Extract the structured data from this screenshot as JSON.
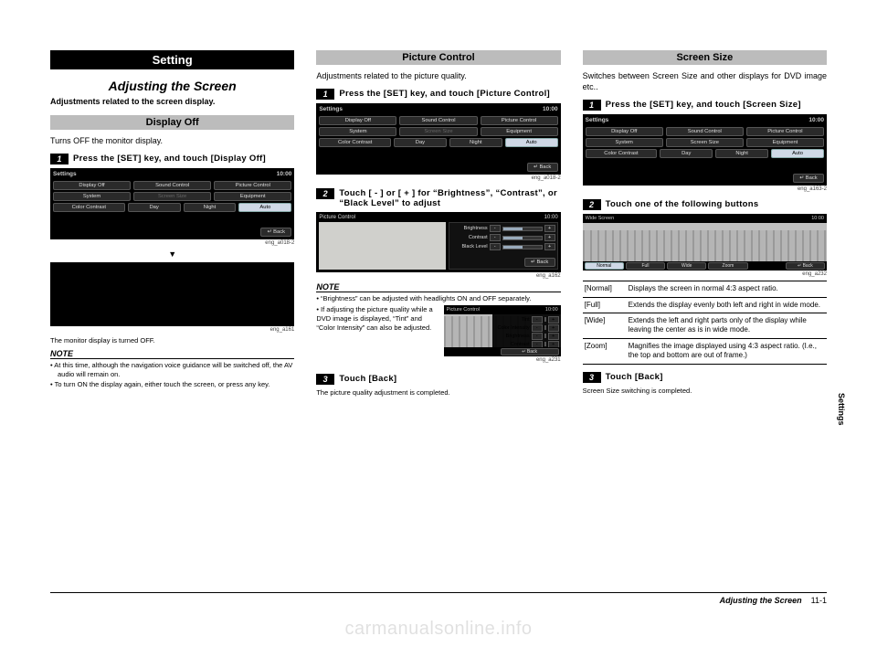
{
  "col1": {
    "setting_block": "Setting",
    "section_title": "Adjusting the Screen",
    "section_sub": "Adjustments related to the screen display.",
    "display_off_head": "Display Off",
    "p1": "Turns OFF the monitor display.",
    "step1": "Press the [SET] key, and touch [Display Off]",
    "fig1_cap": "eng_a018-2",
    "fig2_cap": "eng_a161",
    "monitor_off_small": "The monitor display is turned OFF.",
    "note_head": "NOTE",
    "note_items": [
      "At this time, although the navigation voice guidance will be switched off, the AV audio will remain on.",
      "To turn ON the display again, either touch the screen, or press any key."
    ]
  },
  "col2": {
    "picture_control_head": "Picture Control",
    "p1": "Adjustments related to the picture quality.",
    "step1": "Press the [SET] key, and touch [Picture Control]",
    "fig1_cap": "eng_a018-2",
    "step2": "Touch [ - ] or [ + ] for “Brightness”, “Contrast”, or “Black Level” to adjust",
    "fig2_cap": "eng_a162",
    "note_head": "NOTE",
    "note_item1": "“Brightness” can be adjusted with headlights ON and OFF separately.",
    "note_item2": "If adjusting the picture quality while a DVD image is displayed, “Tint” and “Color Intensity” can also be adjusted.",
    "inset_cap": "eng_a231",
    "step3": "Touch [Back]",
    "p_after3": "The picture quality adjustment is completed."
  },
  "col3": {
    "screen_size_head": "Screen Size",
    "p1": "Switches between Screen Size and other displays for DVD image etc..",
    "step1": "Press the [SET] key, and touch [Screen Size]",
    "fig1_cap": "eng_a163-2",
    "step2": "Touch one of the following buttons",
    "fig2_cap": "eng_a232",
    "table": [
      {
        "k": "[Normal]",
        "v": "Displays the screen in normal 4:3 aspect ratio."
      },
      {
        "k": "[Full]",
        "v": "Extends the display evenly both left and right in wide mode."
      },
      {
        "k": "[Wide]",
        "v": "Extends the left and right parts only of the display while leaving the center as is in wide mode."
      },
      {
        "k": "[Zoom]",
        "v": "Magnifies the image displayed using 4:3 aspect ratio. (I.e., the top and bottom are out of frame.)"
      }
    ],
    "step3": "Touch [Back]",
    "p_after3": "Screen Size switching is completed."
  },
  "screens": {
    "settings": {
      "title": "Settings",
      "time": "10:00",
      "row1": [
        "Display Off",
        "Sound Control",
        "Picture Control"
      ],
      "row2": [
        "System",
        "Screen Size",
        "Equipment"
      ],
      "cc_label": "Color Contrast",
      "cc_opts": [
        "Day",
        "Night",
        "Auto"
      ],
      "back": "Back"
    },
    "picture_sliders": {
      "title": "Picture Control",
      "time": "10:00",
      "rows": [
        "Brightness",
        "Contrast",
        "Black Level"
      ],
      "back": "Back"
    },
    "picture_sliders_dvd": {
      "title": "Picture Control",
      "time": "10:00",
      "rows": [
        "Tint",
        "Color Intensity",
        "Brightness",
        "Contrast",
        "Black Level"
      ],
      "back": "Back"
    },
    "wide": {
      "title": "Wide Screen",
      "time": "10:00",
      "opts": [
        "Normal",
        "Full",
        "Wide",
        "Zoom"
      ],
      "back": "Back"
    }
  },
  "side_tab": "Settings",
  "footer": {
    "title": "Adjusting the Screen",
    "page": "11-1"
  },
  "watermark": "carmanualsonline.info"
}
